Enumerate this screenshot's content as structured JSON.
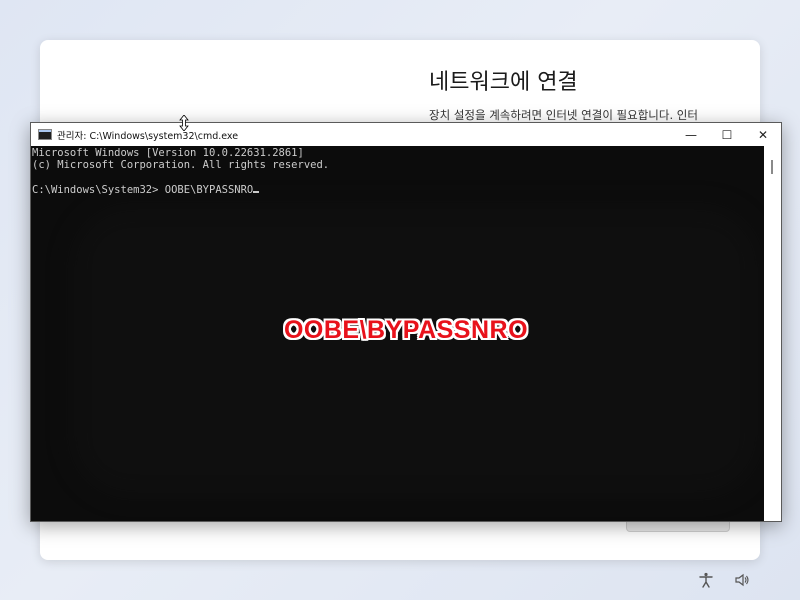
{
  "oobe": {
    "title": "네트워크에 연결",
    "description": "장치 설정을 계속하려면 인터넷 연결이 필요합니다. 인터"
  },
  "cmd": {
    "window_title": "관리자: C:\\Windows\\system32\\cmd.exe",
    "lines": [
      "Microsoft Windows [Version 10.0.22631.2861]",
      "(c) Microsoft Corporation. All rights reserved.",
      "",
      "C:\\Windows\\System32> OOBE\\BYPASSNRO"
    ],
    "controls": {
      "minimize": "—",
      "maximize": "☐",
      "close": "✕"
    }
  },
  "overlay": {
    "caption": "OOBE\\BYPASSNRO"
  },
  "colors": {
    "console_bg": "#0c0c0c",
    "console_fg": "#cccccc",
    "caption_red": "#e8121b"
  },
  "icons": {
    "accessibility": "accessibility-icon",
    "volume": "volume-icon"
  }
}
